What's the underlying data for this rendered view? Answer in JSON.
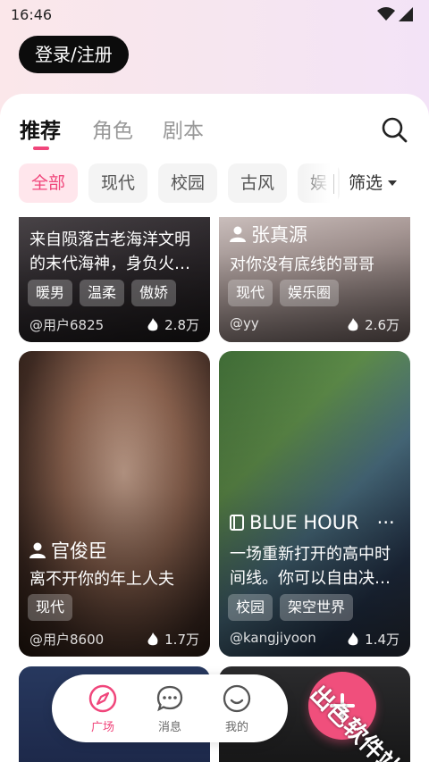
{
  "status_bar": {
    "time": "16:46"
  },
  "header": {
    "login_label": "登录/注册"
  },
  "tabs": [
    {
      "label": "推荐",
      "active": true
    },
    {
      "label": "角色",
      "active": false
    },
    {
      "label": "剧本",
      "active": false
    }
  ],
  "filters": {
    "chips": [
      {
        "label": "全部",
        "active": true
      },
      {
        "label": "现代",
        "active": false
      },
      {
        "label": "校园",
        "active": false
      },
      {
        "label": "古风",
        "active": false
      },
      {
        "label": "娱",
        "active": false
      }
    ],
    "filter_label": "筛选"
  },
  "cards": [
    {
      "type": "character",
      "name": "",
      "description": "来自陨落古老海洋文明的末代海神，身负火…",
      "tags": [
        "暖男",
        "温柔",
        "傲娇"
      ],
      "user": "@用户6825",
      "heat": "2.8万"
    },
    {
      "type": "character",
      "name": "张真源",
      "description": "对你没有底线的哥哥",
      "tags": [
        "现代",
        "娱乐圈"
      ],
      "user": "@yy",
      "heat": "2.6万"
    },
    {
      "type": "character",
      "name": "官俊臣",
      "description": "离不开你的年上人夫",
      "tags": [
        "现代"
      ],
      "user": "@用户8600",
      "heat": "1.7万"
    },
    {
      "type": "script",
      "name": "BLUE HOUR",
      "more": "···",
      "description": "一场重新打开的高中时间线。你可以自由决…",
      "tags": [
        "校园",
        "架空世界"
      ],
      "user": "@kangjiyoon",
      "heat": "1.4万"
    }
  ],
  "bottom_nav": [
    {
      "label": "广场",
      "icon": "compass-icon",
      "active": true
    },
    {
      "label": "消息",
      "icon": "chat-bubble-icon",
      "active": false
    },
    {
      "label": "我的",
      "icon": "smiley-icon",
      "active": false
    }
  ],
  "watermark": "出色软件站",
  "colors": {
    "accent": "#f0467b",
    "dark_button": "#0c0c0c"
  }
}
